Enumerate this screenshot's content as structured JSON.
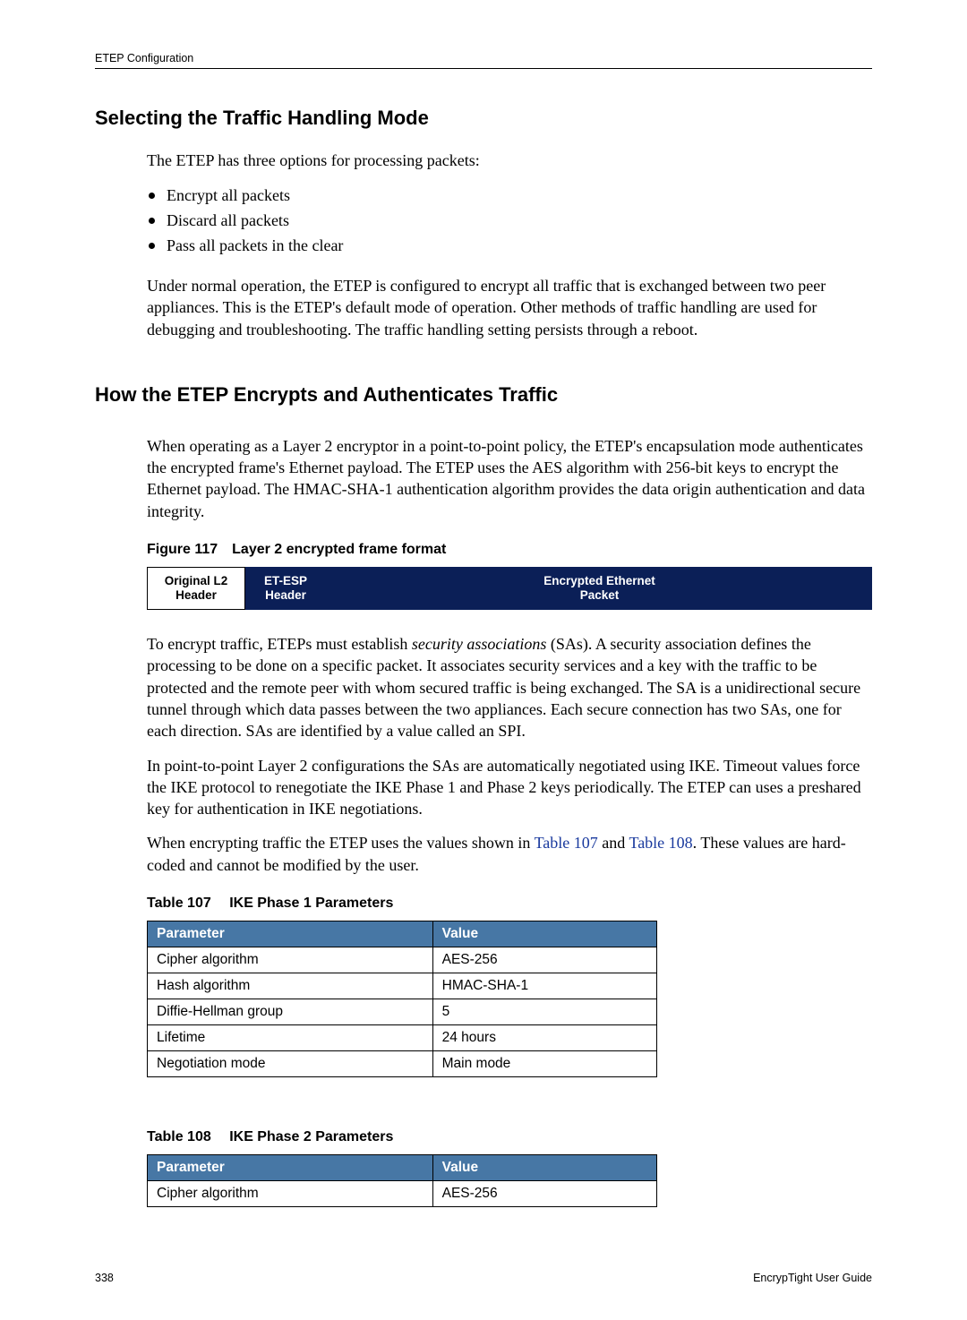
{
  "header": {
    "breadcrumb": "ETEP Configuration"
  },
  "section1": {
    "heading": "Selecting the Traffic Handling Mode",
    "intro": "The ETEP has three options for processing packets:",
    "bullets": [
      "Encrypt all packets",
      "Discard all packets",
      "Pass all packets in the clear"
    ],
    "para2": "Under normal operation, the ETEP is configured to encrypt all traffic that is exchanged between two peer appliances. This is the ETEP's default mode of operation. Other methods of traffic handling are used for debugging and troubleshooting. The traffic handling setting persists through a reboot."
  },
  "section2": {
    "heading": "How the ETEP Encrypts and Authenticates Traffic",
    "intro": "When operating as a Layer 2 encryptor in a point-to-point policy, the ETEP's encapsulation mode authenticates the encrypted frame's Ethernet payload. The ETEP uses the AES algorithm with 256-bit keys to encrypt the Ethernet payload. The HMAC-SHA-1 authentication algorithm provides the data origin authentication and data integrity.",
    "figure_caption": "Figure 117 Layer 2 encrypted frame format",
    "figure": {
      "box1_line1": "Original L2",
      "box1_line2": "Header",
      "box2_line1": "ET-ESP",
      "box2_line2": "Header",
      "box3_line1": "Encrypted Ethernet",
      "box3_line2": "Packet"
    },
    "para_sa_pre": "To encrypt traffic, ETEPs must establish ",
    "para_sa_italic": "security associations",
    "para_sa_post": " (SAs). A security association defines the processing to be done on a specific packet. It associates security services and a key with the traffic to be protected and the remote peer with whom secured traffic is being exchanged. The SA is a unidirectional secure tunnel through which data passes between the two appliances. Each secure connection has two SAs, one for each direction. SAs are identified by a value called an SPI.",
    "para_ike": "In point-to-point Layer 2 configurations the SAs are automatically negotiated using IKE. Timeout values force the IKE protocol to renegotiate the IKE Phase 1 and Phase 2 keys periodically. The ETEP can uses a preshared key for authentication in IKE negotiations.",
    "para_tables_pre": "When encrypting traffic the ETEP uses the values shown in ",
    "para_tables_link1": "Table 107",
    "para_tables_mid": " and ",
    "para_tables_link2": "Table 108",
    "para_tables_post": ". These values are hard-coded and cannot be modified by the user."
  },
  "table107": {
    "caption": "Table 107  IKE Phase 1 Parameters",
    "headers": [
      "Parameter",
      "Value"
    ],
    "rows": [
      [
        "Cipher algorithm",
        "AES-256"
      ],
      [
        "Hash algorithm",
        "HMAC-SHA-1"
      ],
      [
        "Diffie-Hellman group",
        "5"
      ],
      [
        "Lifetime",
        "24 hours"
      ],
      [
        "Negotiation mode",
        "Main mode"
      ]
    ]
  },
  "table108": {
    "caption": "Table 108  IKE Phase 2 Parameters",
    "headers": [
      "Parameter",
      "Value"
    ],
    "rows": [
      [
        "Cipher algorithm",
        "AES-256"
      ]
    ]
  },
  "footer": {
    "page_number": "338",
    "doc_title": "EncrypTight User Guide"
  }
}
